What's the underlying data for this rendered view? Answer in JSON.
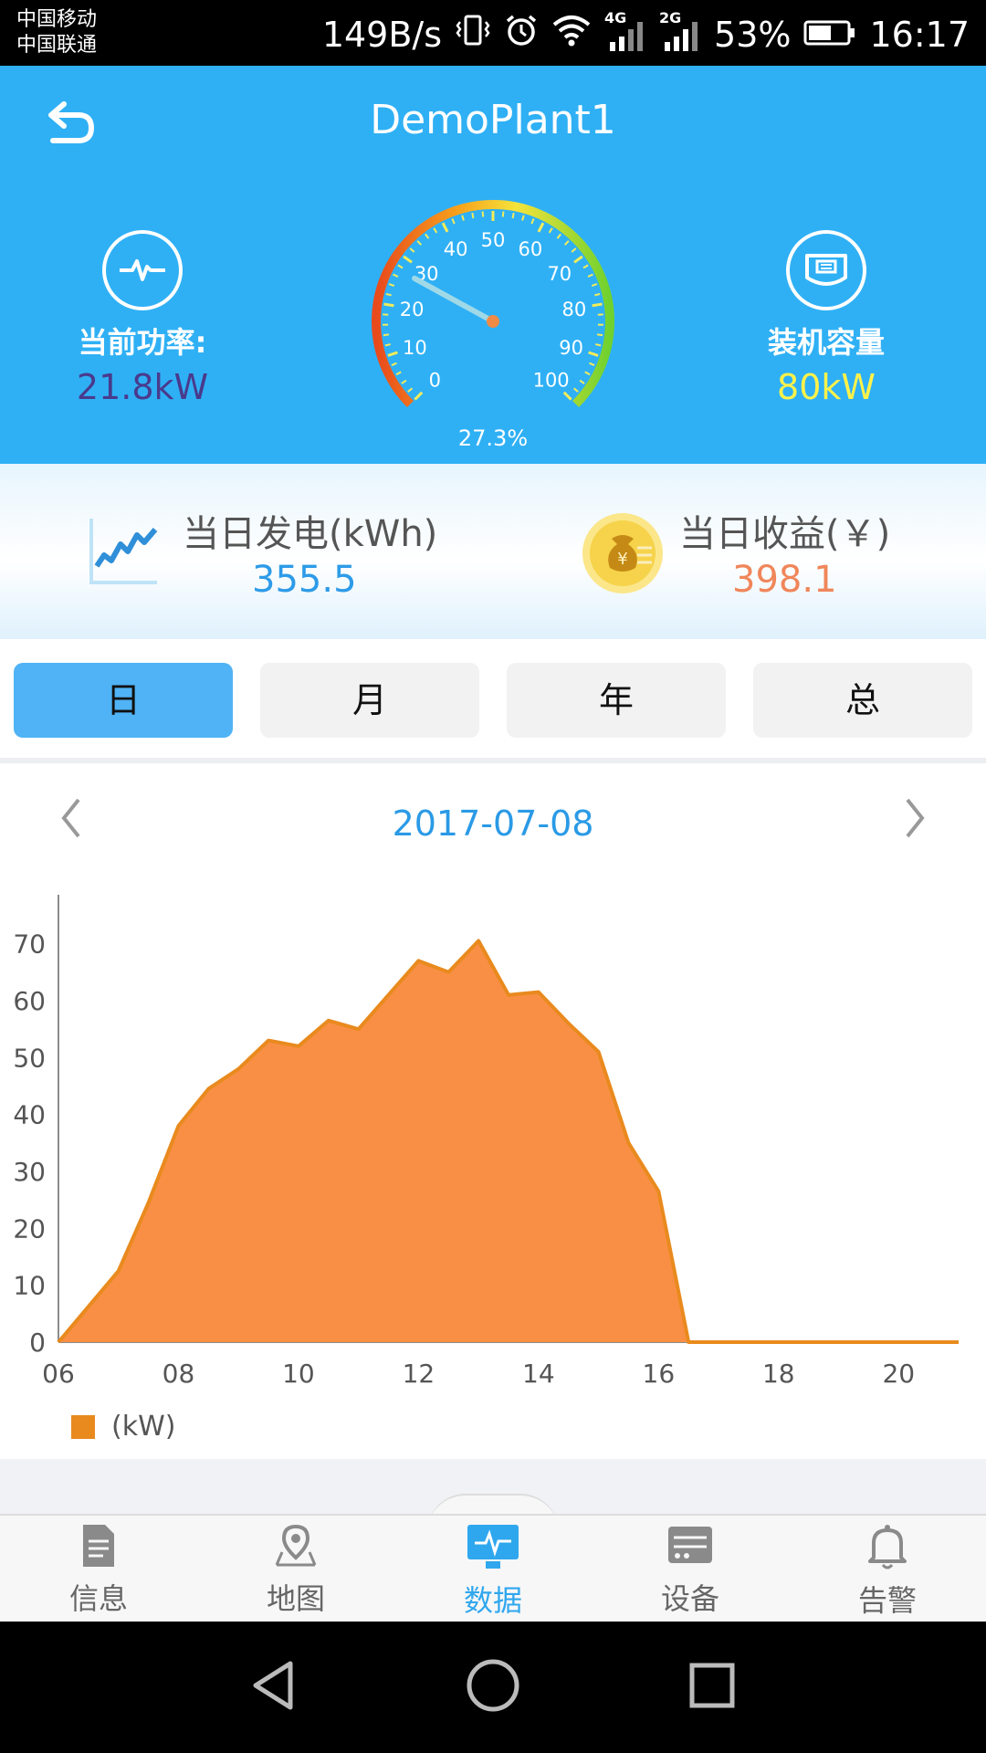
{
  "status_bar": {
    "carriers": [
      "中国移动",
      "中国联通"
    ],
    "speed": "149B/s",
    "net_4g": "4G",
    "net_2g": "2G",
    "battery": "53%",
    "time": "16:17"
  },
  "header": {
    "title": "DemoPlant1",
    "current_power_label": "当前功率:",
    "current_power_value": "21.8kW",
    "capacity_label": "装机容量",
    "capacity_value": "80kW",
    "gauge": {
      "ticks": [
        "0",
        "10",
        "20",
        "30",
        "40",
        "50",
        "60",
        "70",
        "80",
        "90",
        "100"
      ],
      "percent_text": "27.3%",
      "value": 27.3
    }
  },
  "summary": {
    "energy_label": "当日发电(kWh)",
    "energy_value": "355.5",
    "income_label": "当日收益(￥)",
    "income_value": "398.1",
    "coin_glyph": "¥"
  },
  "tabs": [
    {
      "label": "日",
      "active": true
    },
    {
      "label": "月",
      "active": false
    },
    {
      "label": "年",
      "active": false
    },
    {
      "label": "总",
      "active": false
    }
  ],
  "date_nav": {
    "date": "2017-07-08"
  },
  "chart_data": {
    "type": "area",
    "title": "",
    "xlabel": "",
    "ylabel": "",
    "x_tick_labels": [
      "06",
      "08",
      "10",
      "12",
      "14",
      "16",
      "18",
      "20"
    ],
    "y_tick_labels": [
      "0",
      "10",
      "20",
      "30",
      "40",
      "50",
      "60",
      "70"
    ],
    "xlim": [
      6,
      21
    ],
    "ylim": [
      0,
      77
    ],
    "grid": false,
    "legend": "bottom-left",
    "series": [
      {
        "name": "(kW)",
        "color": "#e98a1e",
        "fill": "#f98f44",
        "x": [
          6,
          7,
          7.5,
          8,
          8.5,
          9,
          9.5,
          10,
          10.5,
          11,
          11.5,
          12,
          12.5,
          13,
          13.5,
          14,
          14.5,
          15,
          15.5,
          16,
          16.5,
          17,
          18,
          19,
          20,
          21
        ],
        "y": [
          0,
          12.5,
          24.5,
          38,
          44.5,
          48,
          53,
          52,
          56.5,
          55,
          61,
          67,
          65,
          70.5,
          61,
          61.5,
          56,
          51,
          35,
          26.5,
          0,
          0,
          0,
          0,
          0,
          0
        ]
      }
    ]
  },
  "bottom_nav": [
    {
      "label": "信息",
      "icon": "document-icon",
      "active": false
    },
    {
      "label": "地图",
      "icon": "map-pin-icon",
      "active": false
    },
    {
      "label": "数据",
      "icon": "monitor-icon",
      "active": true
    },
    {
      "label": "设备",
      "icon": "device-icon",
      "active": false
    },
    {
      "label": "告警",
      "icon": "bell-icon",
      "active": false
    }
  ],
  "colors": {
    "header_bg": "#2fb0f5",
    "power_value": "#4a3a8c",
    "capacity_value": "#fff24a",
    "energy_value": "#2d9be8",
    "income_value": "#f0865a",
    "active_tab": "#4fb3f5",
    "nav_active": "#2fa7ee"
  }
}
